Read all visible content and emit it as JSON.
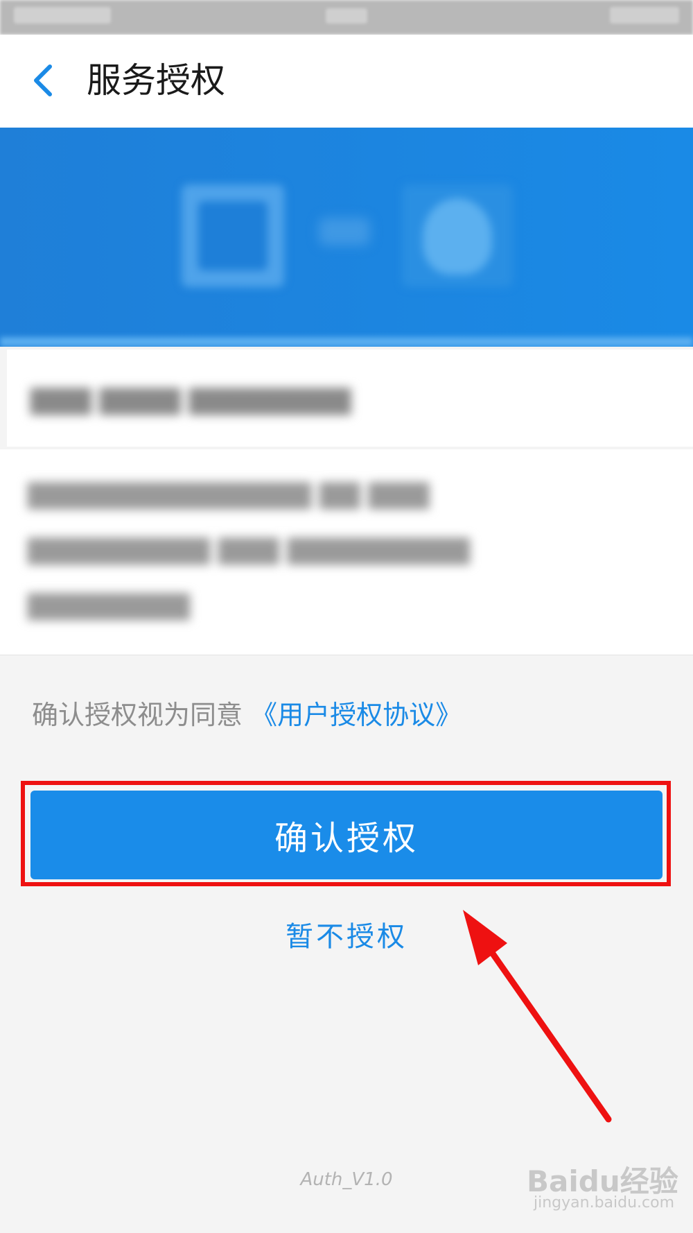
{
  "header": {
    "title": "服务授权",
    "back_icon": "chevron-left-icon"
  },
  "colors": {
    "accent": "#1a8ae6",
    "button": "#1a8ce9",
    "highlight": "#ee1111",
    "banner": "#1f7fd8"
  },
  "agreement": {
    "prefix": "确认授权视为同意",
    "link": "《用户授权协议》"
  },
  "actions": {
    "confirm_label": "确认授权",
    "decline_label": "暂不授权"
  },
  "footer": {
    "version": "Auth_V1.0"
  },
  "watermark": {
    "logo": "Baidu经验",
    "url": "jingyan.baidu.com"
  }
}
